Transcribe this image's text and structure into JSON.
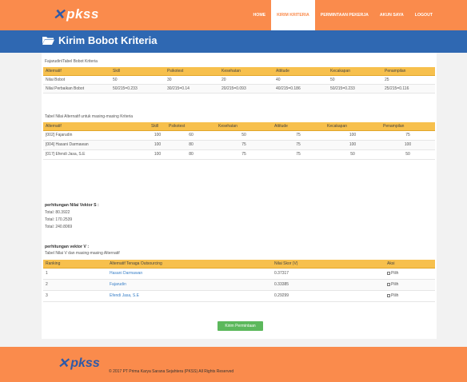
{
  "header": {
    "logo_mark": "✕",
    "logo_text": "pkss",
    "nav": [
      {
        "label": "HOME"
      },
      {
        "label": "KIRIM KRITERIA"
      },
      {
        "label": "PERMINTAAN PEKERJA"
      },
      {
        "label": "AKUN SAYA"
      },
      {
        "label": "LOGOUT"
      }
    ],
    "active_nav": 1
  },
  "page": {
    "title": "Kirim Bobot Kriteria",
    "title_icon": "folder-icon"
  },
  "table1": {
    "caption": "Fajarudin\\Tabel Bobot Kriteria",
    "headers": [
      "Alternatif",
      "Skill",
      "Psikotest",
      "Kesehatan",
      "Attitude",
      "Kecakapan",
      "Penampilan"
    ],
    "rows": [
      [
        "Nilai Bobot",
        "50",
        "30",
        "20",
        "40",
        "50",
        "25"
      ],
      [
        "Nilai Perbaikan Bobot",
        "50/215=0.233",
        "30/215=0.14",
        "20/215=0.093",
        "40/215=0.186",
        "50/215=0.233",
        "25/215=0.116"
      ]
    ]
  },
  "table2": {
    "caption": "Tabel Nilai Alternatif untuk masing-masing Kriteria",
    "headers": [
      "Alternatif",
      "Skill",
      "Psikotest",
      "Kesehatan",
      "Attitude",
      "Kecakapan",
      "Penampilan"
    ],
    "rows": [
      [
        "[002] Fajarudin",
        "100",
        "60",
        "50",
        "75",
        "100",
        "75"
      ],
      [
        "[004] Hasani Darmawan",
        "100",
        "80",
        "75",
        "75",
        "100",
        "100"
      ],
      [
        "[017] Efendi Jasa, S.E",
        "100",
        "80",
        "75",
        "75",
        "50",
        "50"
      ]
    ]
  },
  "vektor_s": {
    "title": "perhitungan Nilai Vektor S :",
    "totals": [
      "Total: 80.3922",
      "Total: 170.2539",
      "Total: 240.8069"
    ]
  },
  "vektor_v": {
    "title": "perhitungan vektor V :",
    "caption": "Tabel Nilai V dan masing-masing Alternatif",
    "headers": [
      "Ranking",
      "Alternatif Tenaga Outsourcing",
      "Nilai Skor (V)",
      "Aksi"
    ],
    "rows": [
      {
        "rank": "1",
        "name": "Hasani Darmawan",
        "score": "0.37317",
        "action": "Pilih"
      },
      {
        "rank": "2",
        "name": "Fajarudin",
        "score": "0.33385",
        "action": "Pilih"
      },
      {
        "rank": "3",
        "name": "Efendi Jasa, S.E",
        "score": "0.29299",
        "action": "Pilih"
      }
    ]
  },
  "submit_label": "Kirim Permintaan",
  "footer": {
    "logo_mark": "✕",
    "logo_text": "pkss",
    "copyright": "© 2017 PT Prima Karya Sarana Sejahtera (PKSS) All Rights Reserved"
  },
  "colors": {
    "brand_orange": "#fa8b4c",
    "title_blue": "#2f68b2",
    "table_header": "#f7c04d",
    "button_green": "#5cb85c",
    "link_blue": "#3a80c8"
  }
}
